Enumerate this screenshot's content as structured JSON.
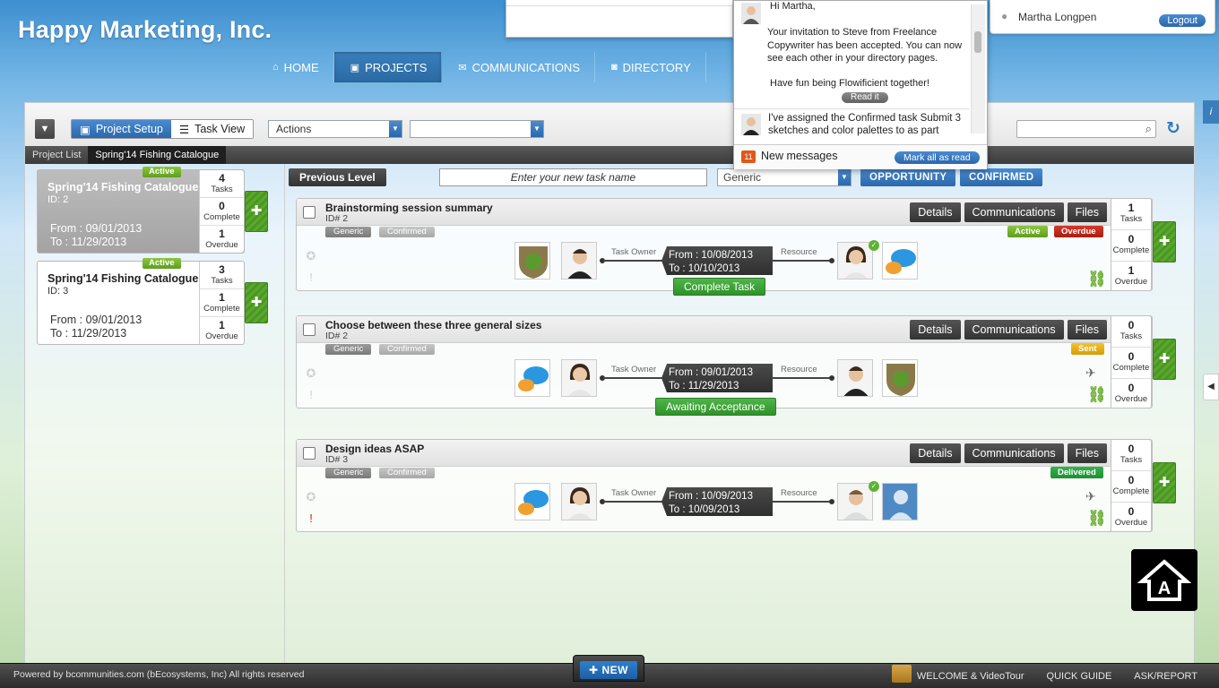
{
  "header": {
    "brand": "Happy Marketing, Inc.",
    "nav": [
      {
        "label": "HOME",
        "icon": "home-icon"
      },
      {
        "label": "PROJECTS",
        "icon": "briefcase-icon",
        "active": true
      },
      {
        "label": "COMMUNICATIONS",
        "icon": "envelope-icon"
      },
      {
        "label": "DIRECTORY",
        "icon": "contacts-icon"
      }
    ],
    "user_name": "Martha Longpen",
    "logout_label": "Logout"
  },
  "toolbar": {
    "project_setup_label": "Project Setup",
    "task_view_label": "Task View",
    "actions_value": "Actions",
    "second_select_value": "",
    "search_placeholder": ""
  },
  "breadcrumb": {
    "items": [
      "Project List",
      "Spring'14 Fishing Catalogue"
    ]
  },
  "projects": [
    {
      "status": "Active",
      "name": "Spring'14 Fishing Catalogue",
      "id": "ID: 2",
      "from": "From : 09/01/2013",
      "to": "To : 11/29/2013",
      "tasks": "4",
      "tasks_label": "Tasks",
      "complete": "0",
      "complete_label": "Complete",
      "overdue": "1",
      "overdue_label": "Overdue"
    },
    {
      "status": "Active",
      "name": "Spring'14 Fishing Catalogue",
      "id": "ID: 3",
      "from": "From : 09/01/2013",
      "to": "To : 11/29/2013",
      "tasks": "3",
      "tasks_label": "Tasks",
      "complete": "1",
      "complete_label": "Complete",
      "overdue": "1",
      "overdue_label": "Overdue"
    }
  ],
  "task_toolbar": {
    "prev_level": "Previous Level",
    "new_task_placeholder": "Enter your new task name",
    "type_select": "Generic",
    "opportunity": "OPPORTUNITY",
    "confirmed": "CONFIRMED"
  },
  "task_buttons": {
    "details": "Details",
    "communications": "Communications",
    "files": "Files"
  },
  "timeline_labels": {
    "owner": "Task Owner",
    "resource": "Resource"
  },
  "tasks": [
    {
      "title": "Brainstorming session summary",
      "id": "ID# 2",
      "tag1": "Generic",
      "tag2": "Confirmed",
      "status1": "Active",
      "status2": "Overdue",
      "from": "From : 10/08/2013",
      "to": "To : 10/10/2013",
      "action": "Complete Task",
      "tasks": "1",
      "complete": "0",
      "overdue": "1"
    },
    {
      "title": "Choose between these three general sizes",
      "id": "ID# 2",
      "tag1": "Generic",
      "tag2": "Confirmed",
      "status1": "Sent",
      "from": "From : 09/01/2013",
      "to": "To : 11/29/2013",
      "action": "Awaiting Acceptance",
      "tasks": "0",
      "complete": "0",
      "overdue": "0"
    },
    {
      "title": "Design ideas ASAP",
      "id": "ID# 3",
      "tag1": "Generic",
      "tag2": "Confirmed",
      "status1": "Delivered",
      "from": "From : 10/09/2013",
      "to": "To : 10/09/2013",
      "tasks": "0",
      "complete": "0",
      "overdue": "0"
    }
  ],
  "stat_labels": {
    "tasks": "Tasks",
    "complete": "Complete",
    "overdue": "Overdue"
  },
  "notifications": {
    "greeting": "Hi Martha,",
    "message1": "Your invitation to Steve from Freelance Copywriter has been accepted. You can now see each other in your directory pages.",
    "message1b": "Have fun being Flowificient together!",
    "read_it": "Read it",
    "message2": "I've assigned the Confirmed task Submit 3 sketches and color palettes to as part",
    "count": "11",
    "new_messages": "New messages",
    "mark_all": "Mark all as read"
  },
  "footer": {
    "powered": "Powered by bcommunities.com (bEcosystems, Inc) All rights reserved",
    "new_label": "NEW",
    "links": [
      "WELCOME & VideoTour",
      "QUICK GUIDE",
      "ASK/REPORT"
    ]
  },
  "colors": {
    "accent_blue": "#2b68ab",
    "green": "#4a9624",
    "overdue_red": "#a91d13",
    "sent_yellow": "#d69c0b"
  }
}
